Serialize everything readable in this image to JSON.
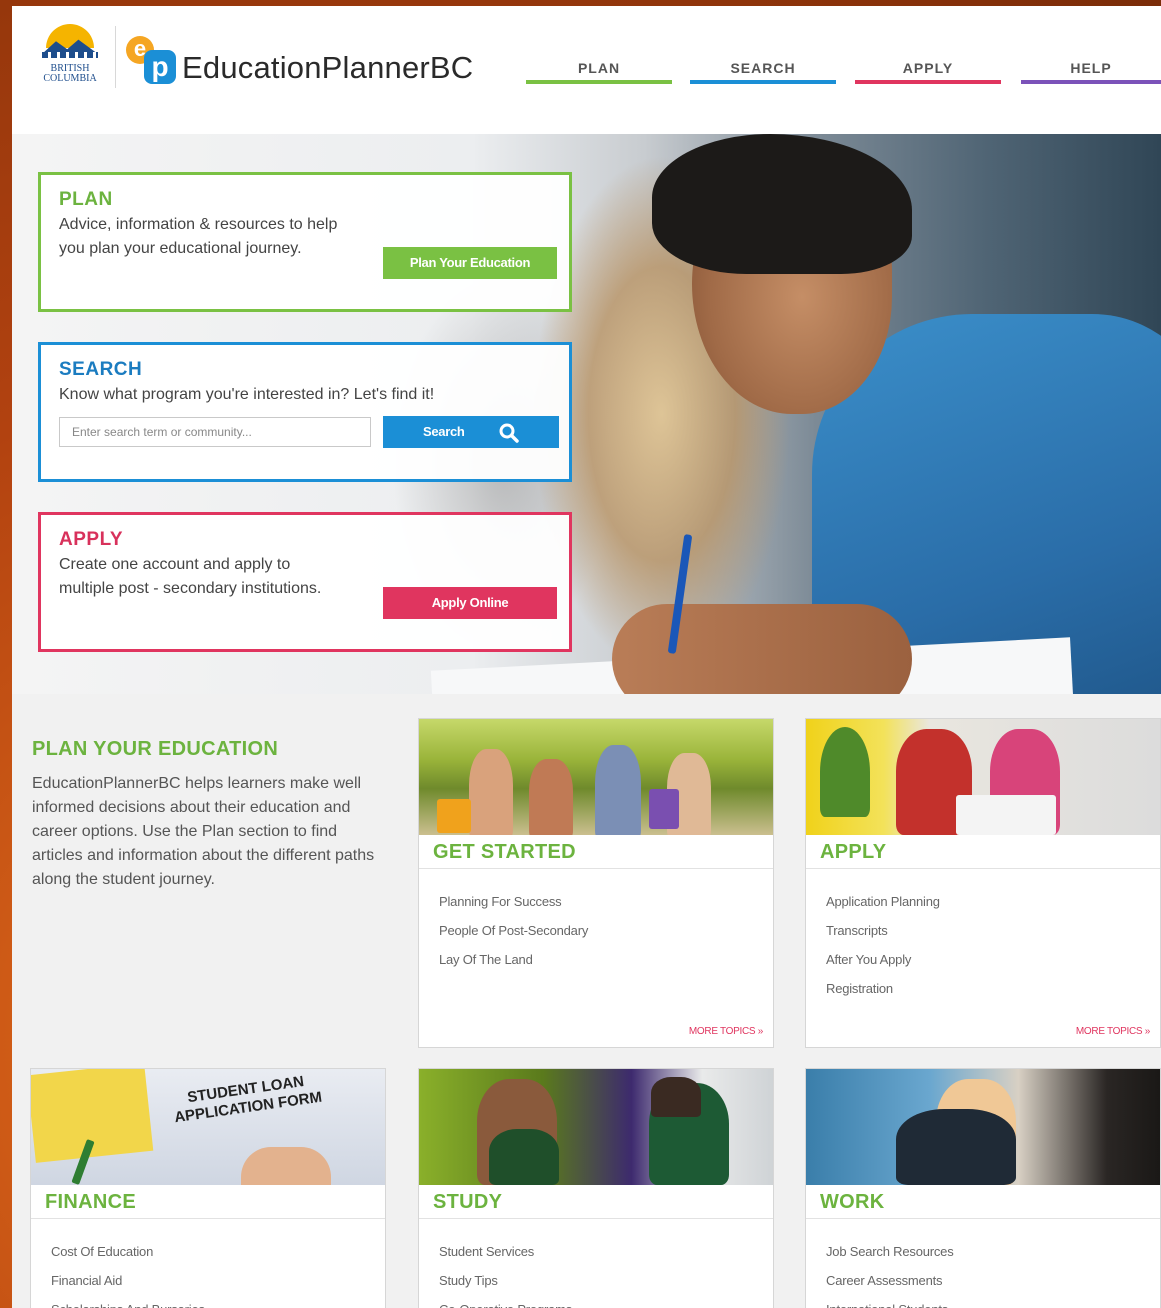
{
  "header": {
    "bc_logo_line1": "BRITISH",
    "bc_logo_line2": "COLUMBIA",
    "ep_logo_e": "e",
    "ep_logo_p": "p",
    "brand": "EducationPlannerBC",
    "nav": [
      {
        "label": "PLAN",
        "color": "#7ac143"
      },
      {
        "label": "SEARCH",
        "color": "#1b8fd6"
      },
      {
        "label": "APPLY",
        "color": "#e0355f"
      },
      {
        "label": "HELP",
        "color": "#7b52b9"
      }
    ]
  },
  "hero": {
    "plan": {
      "title": "PLAN",
      "description": "Advice, information & resources to help you plan your educational journey.",
      "button": "Plan Your Education"
    },
    "search": {
      "title": "SEARCH",
      "description": "Know what program you're interested in? Let's find it!",
      "placeholder": "Enter search term or community...",
      "button": "Search"
    },
    "apply": {
      "title": "APPLY",
      "description": "Create one account and apply to multiple post - secondary institutions.",
      "button": "Apply Online"
    }
  },
  "intro": {
    "title": "PLAN YOUR EDUCATION",
    "text": "EducationPlannerBC helps learners make well informed decisions about their education and career options. Use the Plan section to find articles and information about the different paths along the student journey."
  },
  "finance_image_text": "STUDENT LOAN APPLICATION FORM",
  "tiles": [
    {
      "title": "GET STARTED",
      "items": [
        "Planning For Success",
        "People Of Post-Secondary",
        "Lay Of The Land"
      ],
      "more": "MORE TOPICS »"
    },
    {
      "title": "APPLY",
      "items": [
        "Application Planning",
        "Transcripts",
        "After You Apply",
        "Registration"
      ],
      "more": "MORE TOPICS »"
    },
    {
      "title": "FINANCE",
      "items": [
        "Cost Of Education",
        "Financial Aid",
        "Scholarships And Bursaries"
      ]
    },
    {
      "title": "STUDY",
      "items": [
        "Student Services",
        "Study Tips",
        "Co-Operative Programs"
      ]
    },
    {
      "title": "WORK",
      "items": [
        "Job Search Resources",
        "Career Assessments",
        "International Students"
      ]
    }
  ]
}
